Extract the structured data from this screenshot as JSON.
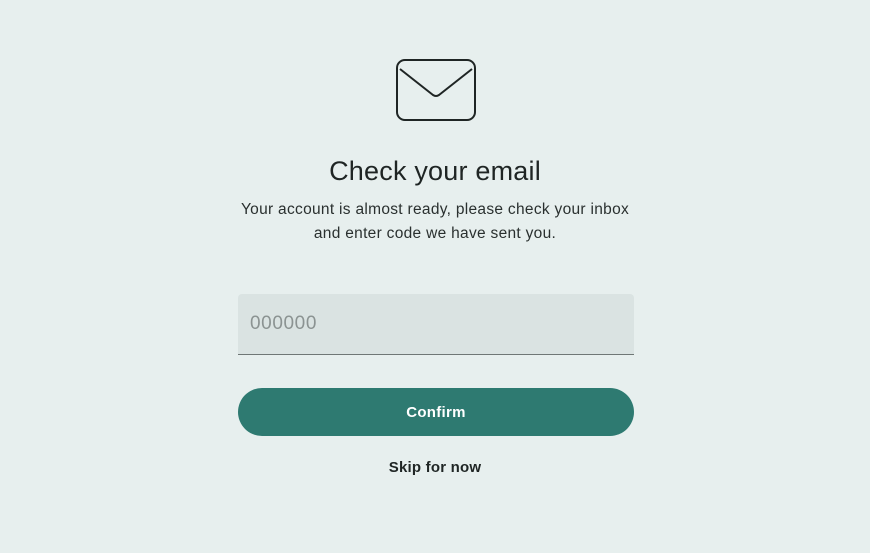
{
  "header": {
    "icon": "envelope-icon",
    "title": "Check your email",
    "subtitle": "Your account is almost ready, please check your inbox and enter code we have sent you."
  },
  "form": {
    "code_placeholder": "000000",
    "code_value": ""
  },
  "actions": {
    "confirm_label": "Confirm",
    "skip_label": "Skip for now"
  },
  "colors": {
    "background": "#e7efee",
    "accent": "#2e7a71",
    "field_background": "#dae3e2"
  }
}
